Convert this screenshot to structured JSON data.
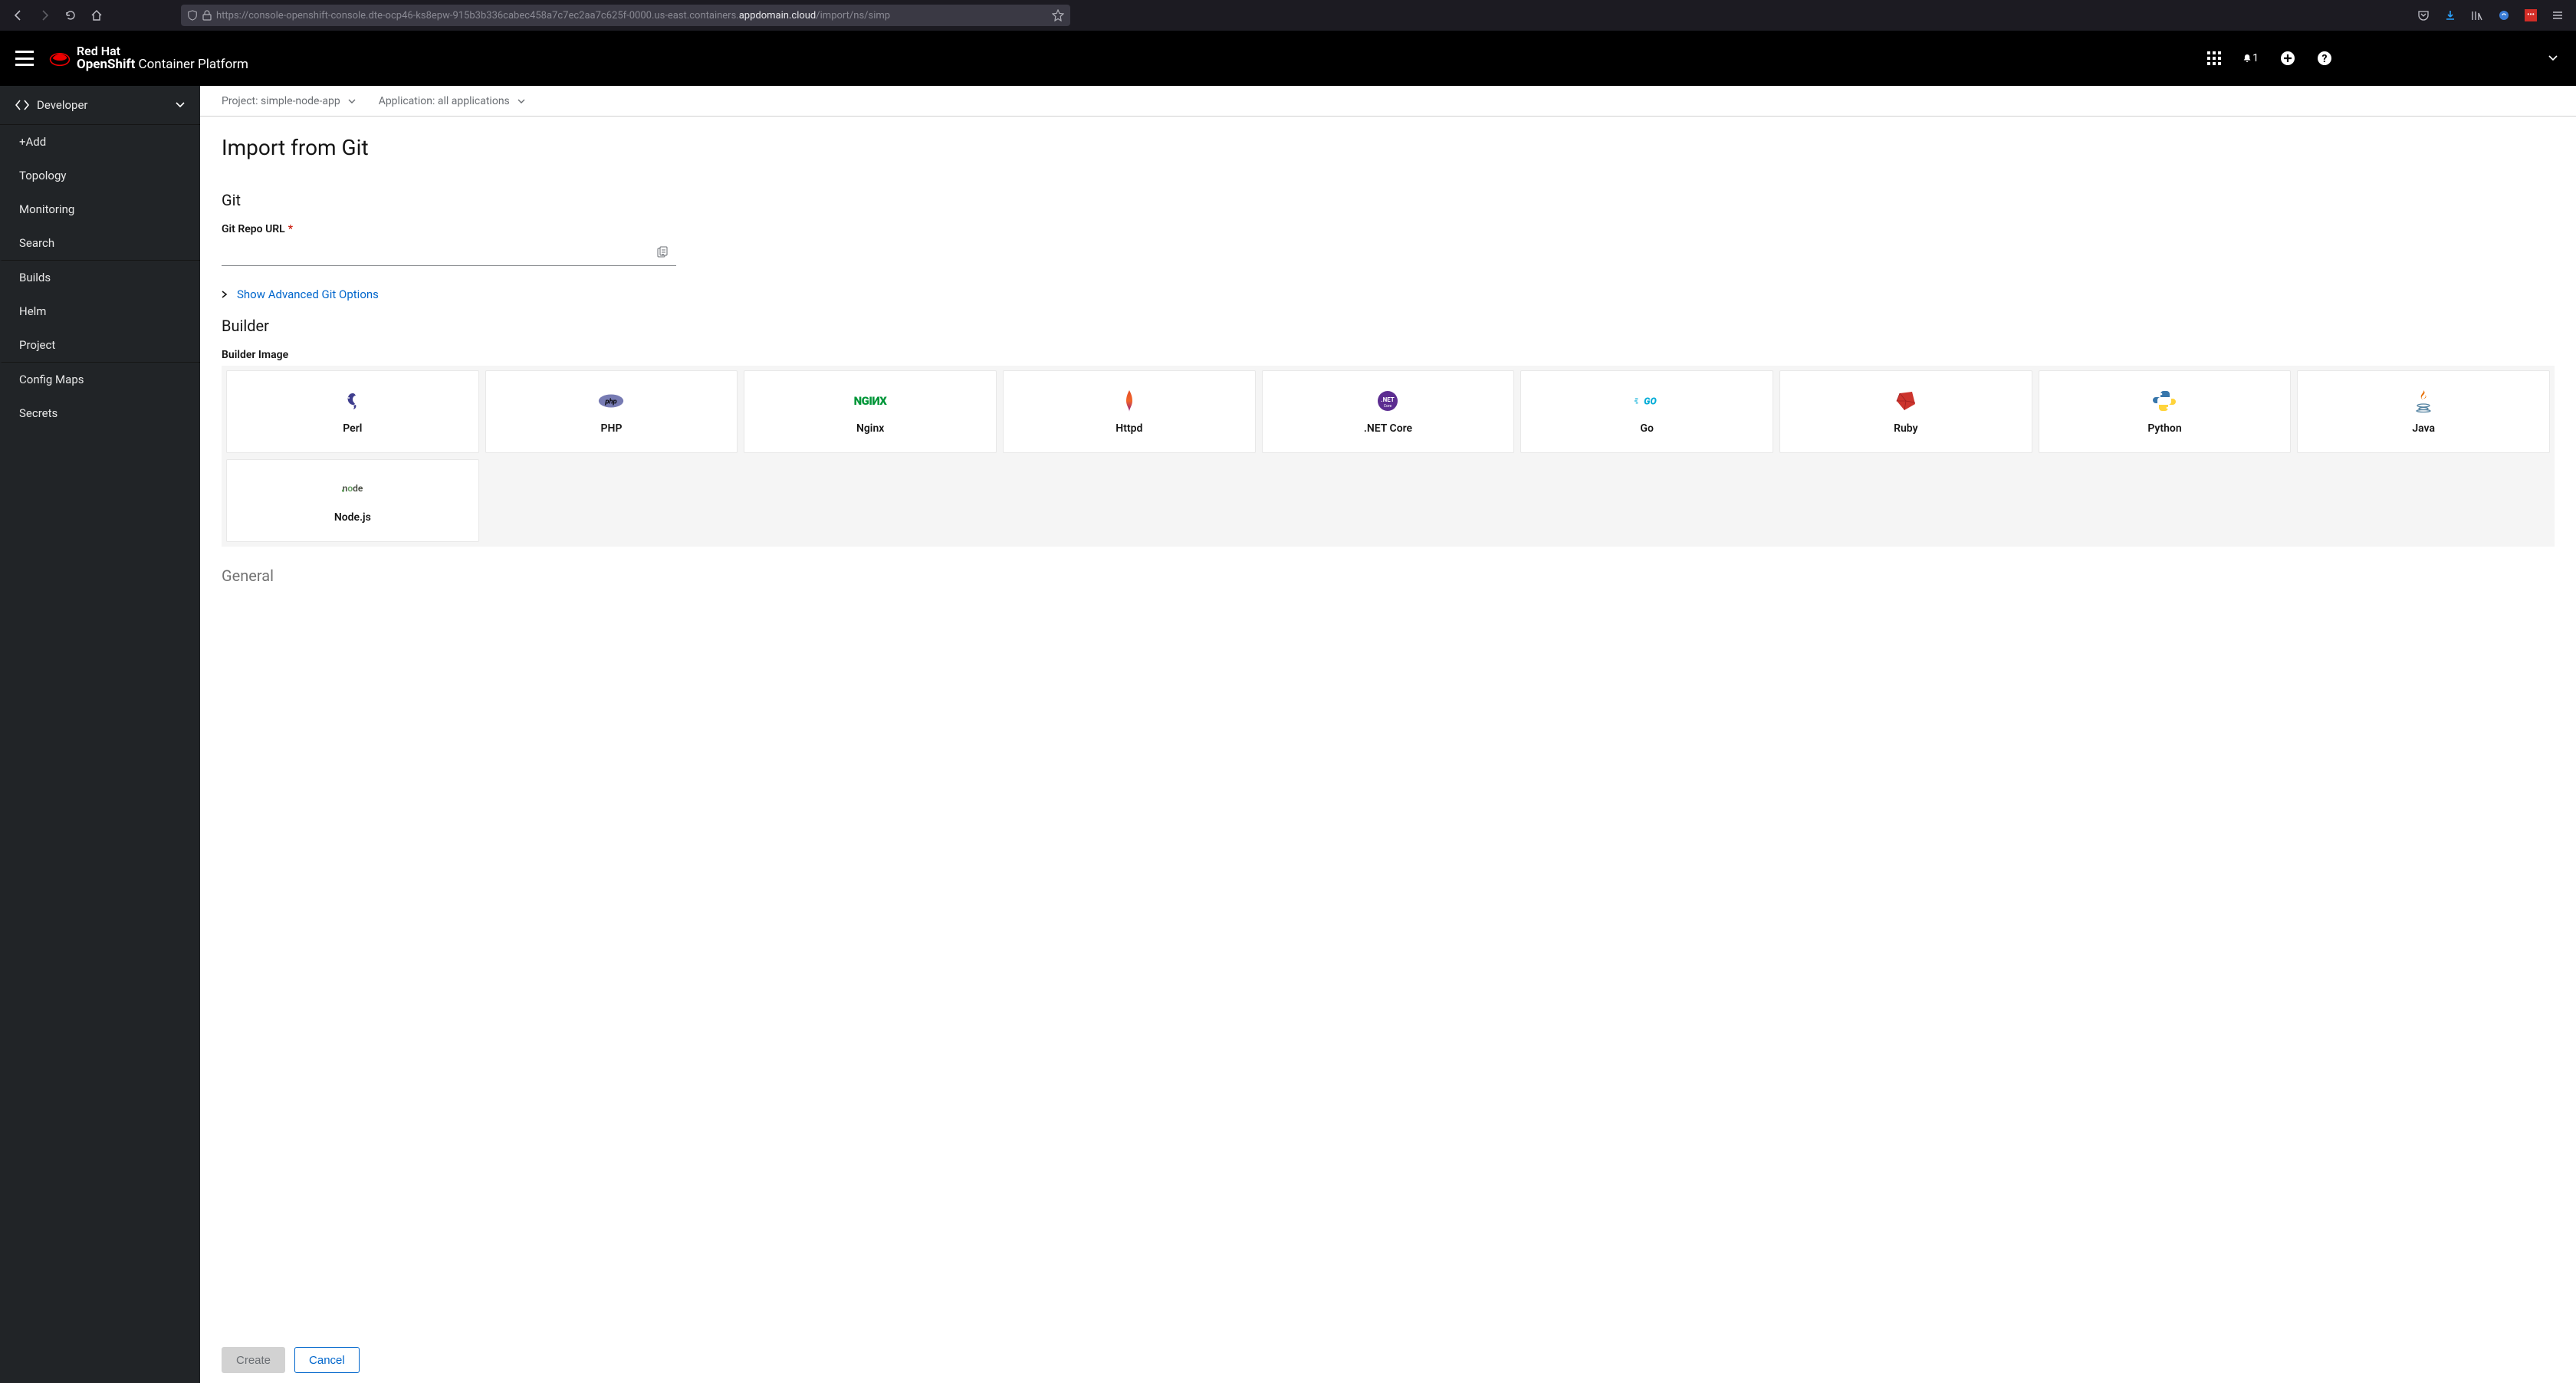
{
  "browser": {
    "url_pre": "https://console-openshift-console.dte-ocp46-ks8epw-915b3b336cabec458a7c7ec2aa7c625f-0000.us-east.containers.",
    "url_bold": "appdomain.cloud",
    "url_post": "/import/ns/simp"
  },
  "brand": {
    "line1": "Red Hat",
    "line2_bold": "OpenShift",
    "line2_rest": " Container Platform"
  },
  "topbar": {
    "notif_count": "1"
  },
  "sidebar": {
    "perspective": "Developer",
    "items": [
      "+Add",
      "Topology",
      "Monitoring",
      "Search",
      "Builds",
      "Helm",
      "Project",
      "Config Maps",
      "Secrets"
    ]
  },
  "context": {
    "project_label": "Project: simple-node-app",
    "app_label": "Application: all applications"
  },
  "page": {
    "title": "Import from Git",
    "git_section": "Git",
    "git_url_label": "Git Repo URL",
    "advanced_link": "Show Advanced Git Options",
    "builder_section": "Builder",
    "builder_label": "Builder Image",
    "general_section": "General"
  },
  "builders": [
    "Perl",
    "PHP",
    "Nginx",
    "Httpd",
    ".NET Core",
    "Go",
    "Ruby",
    "Python",
    "Java",
    "Node.js"
  ],
  "footer": {
    "create": "Create",
    "cancel": "Cancel"
  }
}
